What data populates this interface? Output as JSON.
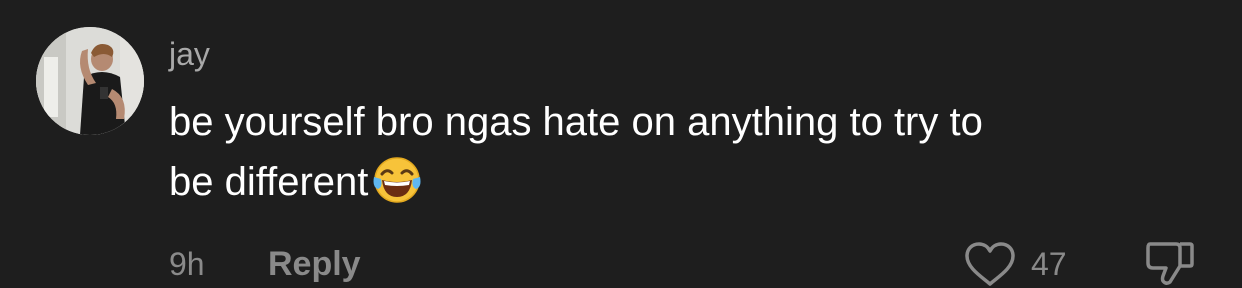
{
  "comment": {
    "username": "jay",
    "text_line1": "be yourself bro ngas hate on anything to try to",
    "text_line2": "be different",
    "emoji": "face-with-tears-of-joy",
    "time": "9h",
    "reply_label": "Reply",
    "like_count": "47"
  },
  "colors": {
    "background": "#1e1e1e",
    "text_primary": "#ffffff",
    "text_secondary": "#a9a9a9",
    "meta": "#8a8a8a"
  },
  "icons": [
    "avatar-photo",
    "face-with-tears-of-joy-icon",
    "heart-icon",
    "thumbs-down-icon"
  ]
}
